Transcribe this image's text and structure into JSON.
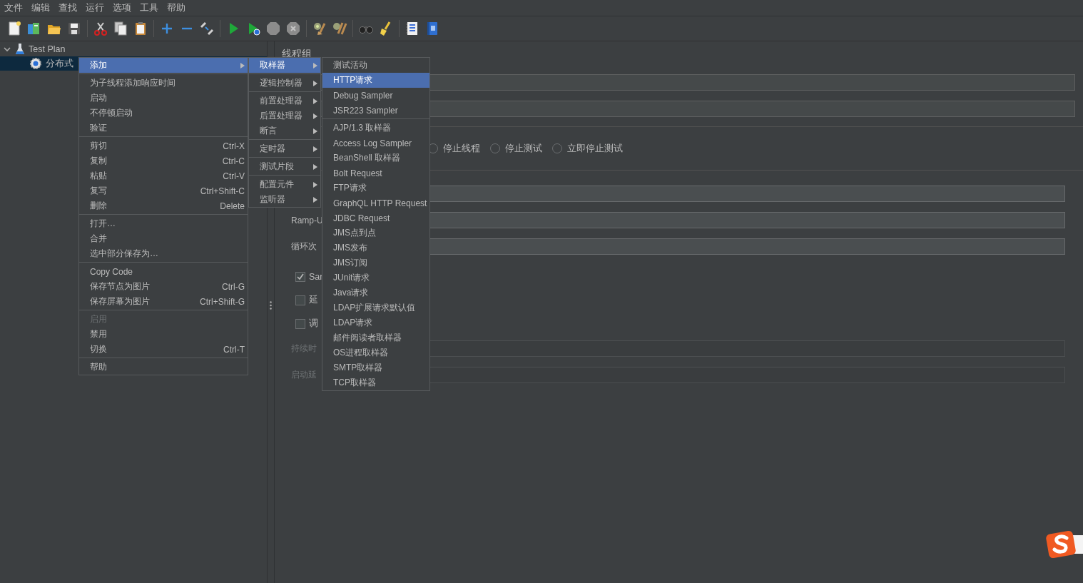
{
  "menu_bar": [
    "文件",
    "编辑",
    "查找",
    "运行",
    "选项",
    "工具",
    "帮助"
  ],
  "tree": [
    {
      "label": "Test Plan",
      "kind": "test_plan",
      "expanded": true,
      "selected": false,
      "children": [
        {
          "label": "分布式",
          "kind": "thread_group",
          "selected": true
        }
      ]
    }
  ],
  "editor": {
    "title": "线程组",
    "on_error_options": [
      {
        "label": "停止线程",
        "selected": false
      },
      {
        "label": "停止测试",
        "selected": false
      },
      {
        "label": "立即停止测试",
        "selected": false
      }
    ],
    "thread_properties": [
      {
        "kind": "field",
        "disabled": false
      },
      {
        "kind": "field",
        "label": "Ramp-U",
        "disabled": false
      },
      {
        "kind": "field",
        "label": "循环次",
        "disabled": false
      },
      {
        "kind": "checkbox",
        "label": "Sar",
        "checked": true
      },
      {
        "kind": "checkbox",
        "label": "延",
        "checked": false
      },
      {
        "kind": "checkbox",
        "label": "调",
        "checked": false
      },
      {
        "kind": "field",
        "label": "持续时",
        "disabled": true
      },
      {
        "kind": "field",
        "label": "启动延",
        "disabled": true
      }
    ]
  },
  "context_menu": {
    "groups": [
      [
        {
          "label": "添加",
          "submenu": true,
          "selected": true,
          "disabled": false
        }
      ],
      [
        {
          "label": "为子线程添加响应时间",
          "submenu": false,
          "selected": false,
          "disabled": false
        },
        {
          "label": "启动",
          "submenu": false,
          "selected": false,
          "disabled": false
        },
        {
          "label": "不停顿启动",
          "submenu": false,
          "selected": false,
          "disabled": false
        },
        {
          "label": "验证",
          "submenu": false,
          "selected": false,
          "disabled": false
        }
      ],
      [
        {
          "label": "剪切",
          "shortcut": "Ctrl-X",
          "submenu": false,
          "selected": false,
          "disabled": false
        },
        {
          "label": "复制",
          "shortcut": "Ctrl-C",
          "submenu": false,
          "selected": false,
          "disabled": false
        },
        {
          "label": "粘贴",
          "shortcut": "Ctrl-V",
          "submenu": false,
          "selected": false,
          "disabled": false
        },
        {
          "label": "复写",
          "shortcut": "Ctrl+Shift-C",
          "submenu": false,
          "selected": false,
          "disabled": false
        },
        {
          "label": "删除",
          "shortcut": "Delete",
          "submenu": false,
          "selected": false,
          "disabled": false
        }
      ],
      [
        {
          "label": "打开…",
          "submenu": false,
          "selected": false,
          "disabled": false
        },
        {
          "label": "合并",
          "submenu": false,
          "selected": false,
          "disabled": false
        },
        {
          "label": "选中部分保存为…",
          "submenu": false,
          "selected": false,
          "disabled": false
        }
      ],
      [
        {
          "label": "Copy Code",
          "submenu": false,
          "selected": false,
          "disabled": false
        },
        {
          "label": "保存节点为图片",
          "shortcut": "Ctrl-G",
          "submenu": false,
          "selected": false,
          "disabled": false
        },
        {
          "label": "保存屏幕为图片",
          "shortcut": "Ctrl+Shift-G",
          "submenu": false,
          "selected": false,
          "disabled": false
        }
      ],
      [
        {
          "label": "启用",
          "submenu": false,
          "selected": false,
          "disabled": true
        },
        {
          "label": "禁用",
          "submenu": false,
          "selected": false,
          "disabled": false
        },
        {
          "label": "切换",
          "shortcut": "Ctrl-T",
          "submenu": false,
          "selected": false,
          "disabled": false
        }
      ],
      [
        {
          "label": "帮助",
          "submenu": false,
          "selected": false,
          "disabled": false
        }
      ]
    ]
  },
  "add_menu": {
    "groups": [
      [
        {
          "label": "取样器",
          "submenu": true,
          "selected": true
        }
      ],
      [
        {
          "label": "逻辑控制器",
          "submenu": true,
          "selected": false
        }
      ],
      [
        {
          "label": "前置处理器",
          "submenu": true,
          "selected": false
        },
        {
          "label": "后置处理器",
          "submenu": true,
          "selected": false
        },
        {
          "label": "断言",
          "submenu": true,
          "selected": false
        }
      ],
      [
        {
          "label": "定时器",
          "submenu": true,
          "selected": false
        }
      ],
      [
        {
          "label": "测试片段",
          "submenu": true,
          "selected": false
        }
      ],
      [
        {
          "label": "配置元件",
          "submenu": true,
          "selected": false
        },
        {
          "label": "监听器",
          "submenu": true,
          "selected": false
        }
      ]
    ]
  },
  "sampler_menu": {
    "groups": [
      [
        {
          "label": "测试活动",
          "selected": false
        },
        {
          "label": "HTTP请求",
          "selected": true
        },
        {
          "label": "Debug Sampler",
          "selected": false
        },
        {
          "label": "JSR223 Sampler",
          "selected": false
        }
      ],
      [
        {
          "label": "AJP/1.3 取样器",
          "selected": false
        },
        {
          "label": "Access Log Sampler",
          "selected": false
        },
        {
          "label": "BeanShell 取样器",
          "selected": false
        },
        {
          "label": "Bolt Request",
          "selected": false
        },
        {
          "label": "FTP请求",
          "selected": false
        },
        {
          "label": "GraphQL HTTP Request",
          "selected": false
        },
        {
          "label": "JDBC Request",
          "selected": false
        },
        {
          "label": "JMS点到点",
          "selected": false
        },
        {
          "label": "JMS发布",
          "selected": false
        },
        {
          "label": "JMS订阅",
          "selected": false
        },
        {
          "label": "JUnit请求",
          "selected": false
        },
        {
          "label": "Java请求",
          "selected": false
        },
        {
          "label": "LDAP扩展请求默认值",
          "selected": false
        },
        {
          "label": "LDAP请求",
          "selected": false
        },
        {
          "label": "邮件阅读者取样器",
          "selected": false
        },
        {
          "label": "OS进程取样器",
          "selected": false
        },
        {
          "label": "SMTP取样器",
          "selected": false
        },
        {
          "label": "TCP取样器",
          "selected": false
        }
      ]
    ]
  }
}
